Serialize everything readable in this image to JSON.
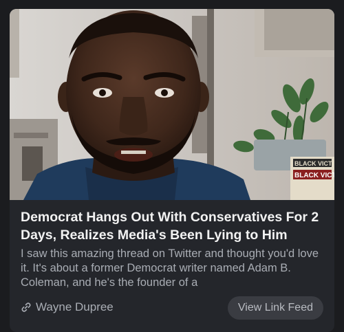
{
  "card": {
    "headline": "Democrat Hangs Out With Conservatives For 2 Days, Realizes Media's Been Lying to Him",
    "excerpt": "I saw this amazing thread on Twitter and thought you'd love it. It's about a former Democrat writer named Adam B. Coleman, and he's the founder of a",
    "author": "Wayne Dupree",
    "link_icon": "link-icon",
    "view_button_label": "View Link Feed",
    "thumbnail": {
      "book_text_line1": "BLACK VICTI",
      "book_text_line2": "BLACK VICTO"
    }
  },
  "colors": {
    "page_background": "#1b1c1f",
    "card_background": "#24262b",
    "headline": "#f2f2f2",
    "body_text": "#a9adb4",
    "button_background": "#3a3c42"
  }
}
